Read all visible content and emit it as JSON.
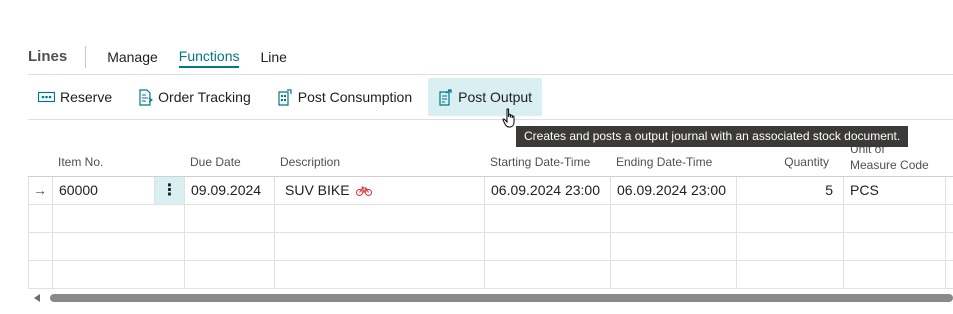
{
  "tabs": {
    "title": "Lines",
    "items": [
      "Manage",
      "Functions",
      "Line"
    ],
    "active": "Functions"
  },
  "toolbar": {
    "reserve": "Reserve",
    "order_tracking": "Order Tracking",
    "post_consumption": "Post Consumption",
    "post_output": "Post Output"
  },
  "tooltip": "Creates and posts a output journal with an associated stock document.",
  "columns": {
    "item_no": "Item No.",
    "due_date": "Due Date",
    "description": "Description",
    "starting": "Starting Date-Time",
    "ending": "Ending Date-Time",
    "quantity": "Quantity",
    "uom_line1": "Unit of",
    "uom_line2": "Measure Code"
  },
  "rows": [
    {
      "arrow": "→",
      "item_no": "60000",
      "menu": "⋮",
      "due_date": "09.09.2024",
      "description": "SUV BIKE",
      "starting": "06.09.2024 23:00",
      "ending": "06.09.2024 23:00",
      "quantity": "5",
      "uom": "PCS"
    }
  ],
  "icons": {
    "reserve": "reserve-icon",
    "order_tracking": "order-tracking-icon",
    "post_consumption": "post-consumption-icon",
    "post_output": "post-output-icon",
    "bike": "bike-icon"
  },
  "colors": {
    "accent": "#00778b",
    "hover": "#d9eff2",
    "tooltip_bg": "#3b3a39",
    "bike_icon": "#d13438"
  }
}
